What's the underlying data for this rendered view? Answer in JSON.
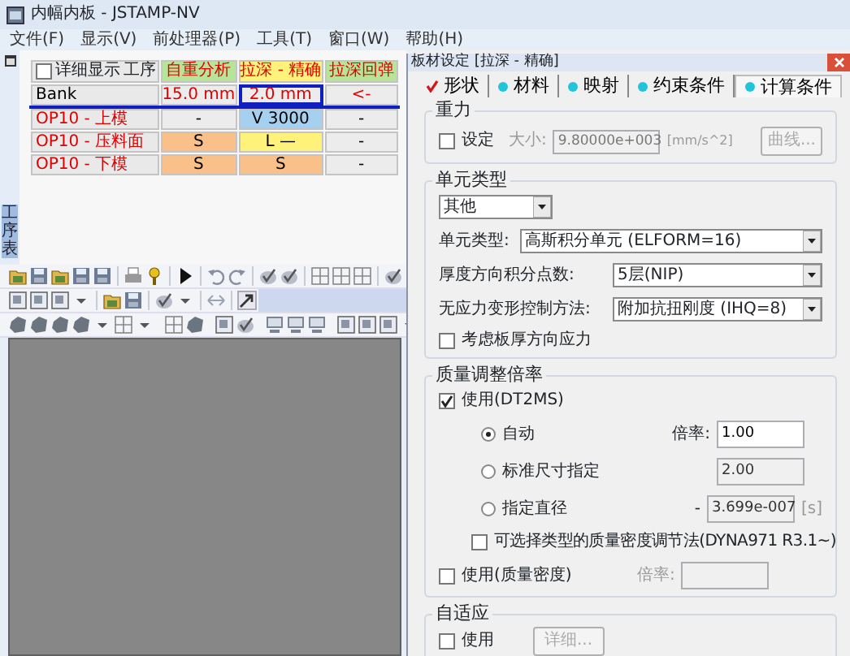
{
  "window": {
    "title": "内幅内板 - JSTAMP-NV"
  },
  "menu": [
    "文件(F)",
    "显示(V)",
    "前处理器(P)",
    "工具(T)",
    "窗口(W)",
    "帮助(H)"
  ],
  "side_panel": {
    "label": "工序表"
  },
  "process_table": {
    "detail_checkbox": {
      "label": "详细显示",
      "checked": false
    },
    "process_header": "工序",
    "columns": [
      {
        "label": "自重分析",
        "color": "#b6e59a"
      },
      {
        "label": "拉深 - 精确",
        "color": "#fff27a"
      },
      {
        "label": "拉深回弹",
        "color": "#b6e59a"
      }
    ],
    "rows": [
      {
        "name": "Bank",
        "kind": "blank",
        "selected": true,
        "cells": [
          {
            "text": "15.0 mm",
            "color": "#ececec",
            "selected": false
          },
          {
            "text": "2.0 mm",
            "color": "#ececec",
            "selected": true
          },
          {
            "text": "<-",
            "color": "#ececec",
            "selected": false
          }
        ]
      },
      {
        "name": "OP10 - 上模",
        "kind": "process",
        "selected": false,
        "cells": [
          {
            "text": "-",
            "color": "#ececec",
            "selected": false
          },
          {
            "text": "V 3000",
            "color": "#a6d0f0",
            "selected": false
          },
          {
            "text": "-",
            "color": "#ececec",
            "selected": false
          }
        ]
      },
      {
        "name": "OP10 - 压料面",
        "kind": "process",
        "selected": false,
        "cells": [
          {
            "text": "S",
            "color": "#f9c08a",
            "selected": false
          },
          {
            "text": "L —",
            "color": "#fff27a",
            "selected": false
          },
          {
            "text": "-",
            "color": "#ececec",
            "selected": false
          }
        ]
      },
      {
        "name": "OP10 - 下模",
        "kind": "process",
        "selected": false,
        "cells": [
          {
            "text": "S",
            "color": "#f9c08a",
            "selected": false
          },
          {
            "text": "S",
            "color": "#f9c08a",
            "selected": false
          },
          {
            "text": "-",
            "color": "#ececec",
            "selected": false
          }
        ]
      }
    ]
  },
  "dialog": {
    "title": "板材设定 [拉深 - 精确]",
    "tabs": [
      {
        "label": "形状",
        "kind": "check",
        "selected": false
      },
      {
        "label": "材料",
        "kind": "dot",
        "selected": false
      },
      {
        "label": "映射",
        "kind": "dot",
        "selected": false
      },
      {
        "label": "约束条件",
        "kind": "dot",
        "selected": false
      },
      {
        "label": "计算条件",
        "kind": "dot",
        "selected": true
      }
    ],
    "gravity": {
      "title": "重力",
      "checkbox": {
        "label": "设定",
        "checked": false
      },
      "size_label": "大小:",
      "value": "9.80000e+003",
      "unit": "[mm/s^2]",
      "button": {
        "label": "曲线...",
        "disabled": true
      }
    },
    "element_type": {
      "title": "单元类型",
      "preset": "其他",
      "fields": [
        {
          "label": "单元类型:",
          "value": "高斯积分单元 (ELFORM=16)"
        },
        {
          "label": "厚度方向积分点数:",
          "value": "5层(NIP)"
        },
        {
          "label": "无应力变形控制方法:",
          "value": "附加抗扭刚度 (IHQ=8)"
        }
      ],
      "checkbox": {
        "label": "考虑板厚方向应力",
        "checked": false
      }
    },
    "mass_scaling": {
      "title": "质量调整倍率",
      "use_checkbox": {
        "label": "使用(DT2MS)",
        "checked": true
      },
      "options": [
        {
          "label": "自动",
          "selected": true,
          "field_label": "倍率:",
          "value": "1.00",
          "editable": true
        },
        {
          "label": "标准尺寸指定",
          "selected": false,
          "value": "2.00",
          "editable": false
        },
        {
          "label": "指定直径",
          "selected": false,
          "field_label": "-",
          "value": "3.699e-007",
          "unit": "[s]",
          "editable": false
        }
      ],
      "type_checkbox": {
        "label": "可选择类型的质量密度调节法(DYNA971 R3.1~)",
        "checked": false
      },
      "density_checkbox": {
        "label": "使用(质量密度)",
        "checked": false
      },
      "density_label": "倍率:"
    },
    "adaptive": {
      "title": "自适应",
      "checkbox": {
        "label": "使用",
        "checked": false
      },
      "button": {
        "label": "详细...",
        "disabled": true
      }
    }
  }
}
